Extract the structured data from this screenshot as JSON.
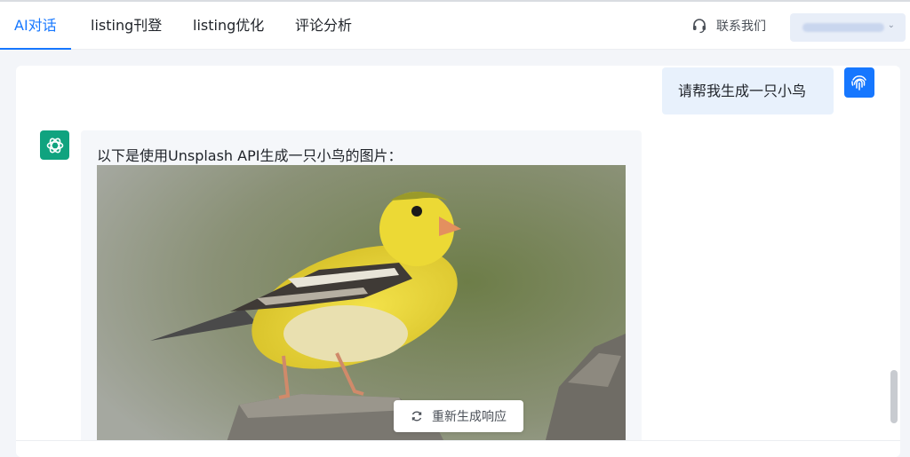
{
  "nav": {
    "tabs": [
      {
        "label": "AI对话",
        "active": true
      },
      {
        "label": "listing刊登",
        "active": false
      },
      {
        "label": "listing优化",
        "active": false
      },
      {
        "label": "评论分析",
        "active": false
      }
    ],
    "contact_label": "联系我们",
    "contact_icon": "headset-icon",
    "user_dropdown_icon": "chevron-down-icon"
  },
  "chat": {
    "user_message": "请帮我生成一只小鸟",
    "user_avatar_icon": "fingerprint-icon",
    "bot_avatar_icon": "openai-logo-icon",
    "bot_message": "以下是使用Unsplash API生成一只小鸟的图片：",
    "image_subject": "yellow-finch-photo",
    "regenerate_label": "重新生成响应",
    "regenerate_icon": "refresh-icon"
  },
  "colors": {
    "accent": "#1677ff",
    "bot_avatar": "#10a37f",
    "user_bubble": "#e8f1fc"
  }
}
